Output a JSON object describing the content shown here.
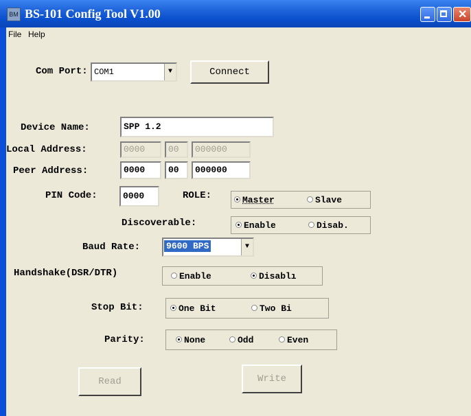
{
  "window": {
    "title": "BS-101 Config Tool V1.00"
  },
  "menu": {
    "file": "File",
    "help": "Help"
  },
  "com_port": {
    "label": "Com Port:",
    "value": "COM1",
    "connect": "Connect"
  },
  "device_name": {
    "label": "Device Name:",
    "value": "SPP 1.2"
  },
  "local_address": {
    "label": "Local Address:",
    "part1": "0000",
    "part2": "00",
    "part3": "000000"
  },
  "peer_address": {
    "label": "Peer Address:",
    "part1": "0000",
    "part2": "00",
    "part3": "000000"
  },
  "pin_code": {
    "label": "PIN Code:",
    "value": "0000"
  },
  "role": {
    "label": "ROLE:",
    "master": "Master",
    "slave": "Slave"
  },
  "discoverable": {
    "label": "Discoverable:",
    "enable": "Enable",
    "disable": "Disab."
  },
  "baud_rate": {
    "label": "Baud Rate:",
    "value": "9600 BPS"
  },
  "handshake": {
    "label": "Handshake(DSR/DTR)",
    "enable": "Enable",
    "disable": "Disablı"
  },
  "stop_bit": {
    "label": "Stop Bit:",
    "one": "One Bit",
    "two": "Two Bi"
  },
  "parity": {
    "label": "Parity:",
    "none": "None",
    "odd": "Odd",
    "even": "Even"
  },
  "buttons": {
    "read": "Read",
    "write": "Write"
  }
}
